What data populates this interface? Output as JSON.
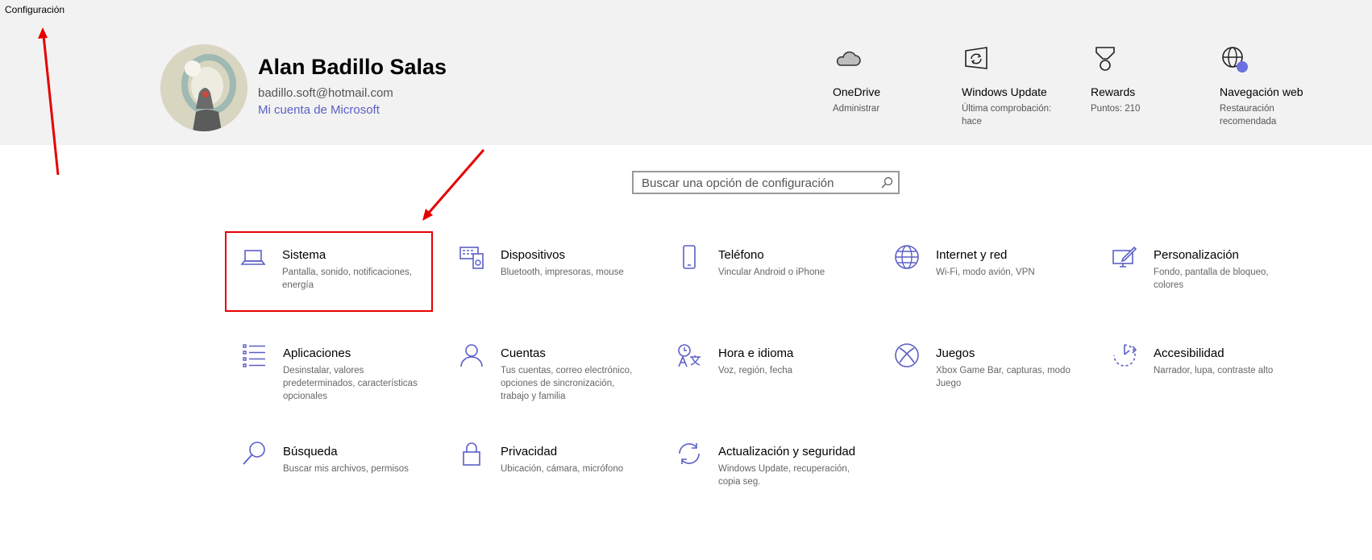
{
  "window": {
    "title": "Configuración"
  },
  "profile": {
    "name": "Alan Badillo Salas",
    "email": "badillo.soft@hotmail.com",
    "account_link": "Mi cuenta de Microsoft"
  },
  "shortcuts": [
    {
      "icon": "cloud-icon",
      "title": "OneDrive",
      "subtitle": "Administrar"
    },
    {
      "icon": "windows-update-icon",
      "title": "Windows Update",
      "subtitle": "Última comprobación: hace"
    },
    {
      "icon": "medal-icon",
      "title": "Rewards",
      "subtitle": "Puntos: 210"
    },
    {
      "icon": "globe-badge-icon",
      "title": "Navegación web",
      "subtitle": "Restauración recomendada"
    }
  ],
  "search": {
    "placeholder": "Buscar una opción de configuración"
  },
  "categories": [
    {
      "icon": "laptop-icon",
      "title": "Sistema",
      "subtitle": "Pantalla, sonido, notificaciones, energía",
      "highlighted": true
    },
    {
      "icon": "devices-icon",
      "title": "Dispositivos",
      "subtitle": "Bluetooth, impresoras, mouse"
    },
    {
      "icon": "phone-icon",
      "title": "Teléfono",
      "subtitle": "Vincular Android o iPhone"
    },
    {
      "icon": "globe-icon",
      "title": "Internet y red",
      "subtitle": "Wi-Fi, modo avión, VPN"
    },
    {
      "icon": "personalization-icon",
      "title": "Personalización",
      "subtitle": "Fondo, pantalla de bloqueo, colores"
    },
    {
      "icon": "apps-list-icon",
      "title": "Aplicaciones",
      "subtitle": "Desinstalar, valores predeterminados, características opcionales"
    },
    {
      "icon": "person-icon",
      "title": "Cuentas",
      "subtitle": "Tus cuentas, correo electrónico, opciones de sincronización, trabajo y familia"
    },
    {
      "icon": "time-language-icon",
      "title": "Hora e idioma",
      "subtitle": "Voz, región, fecha"
    },
    {
      "icon": "xbox-icon",
      "title": "Juegos",
      "subtitle": "Xbox Game Bar, capturas, modo Juego"
    },
    {
      "icon": "accessibility-icon",
      "title": "Accesibilidad",
      "subtitle": "Narrador, lupa, contraste alto"
    },
    {
      "icon": "search-icon",
      "title": "Búsqueda",
      "subtitle": "Buscar mis archivos, permisos"
    },
    {
      "icon": "lock-icon",
      "title": "Privacidad",
      "subtitle": "Ubicación, cámara, micrófono"
    },
    {
      "icon": "sync-icon",
      "title": "Actualización y seguridad",
      "subtitle": "Windows Update, recuperación, copia seg."
    }
  ],
  "colors": {
    "accent": "#5b5fc7",
    "header_bg": "#f2f2f2",
    "annotation": "#e50000"
  }
}
